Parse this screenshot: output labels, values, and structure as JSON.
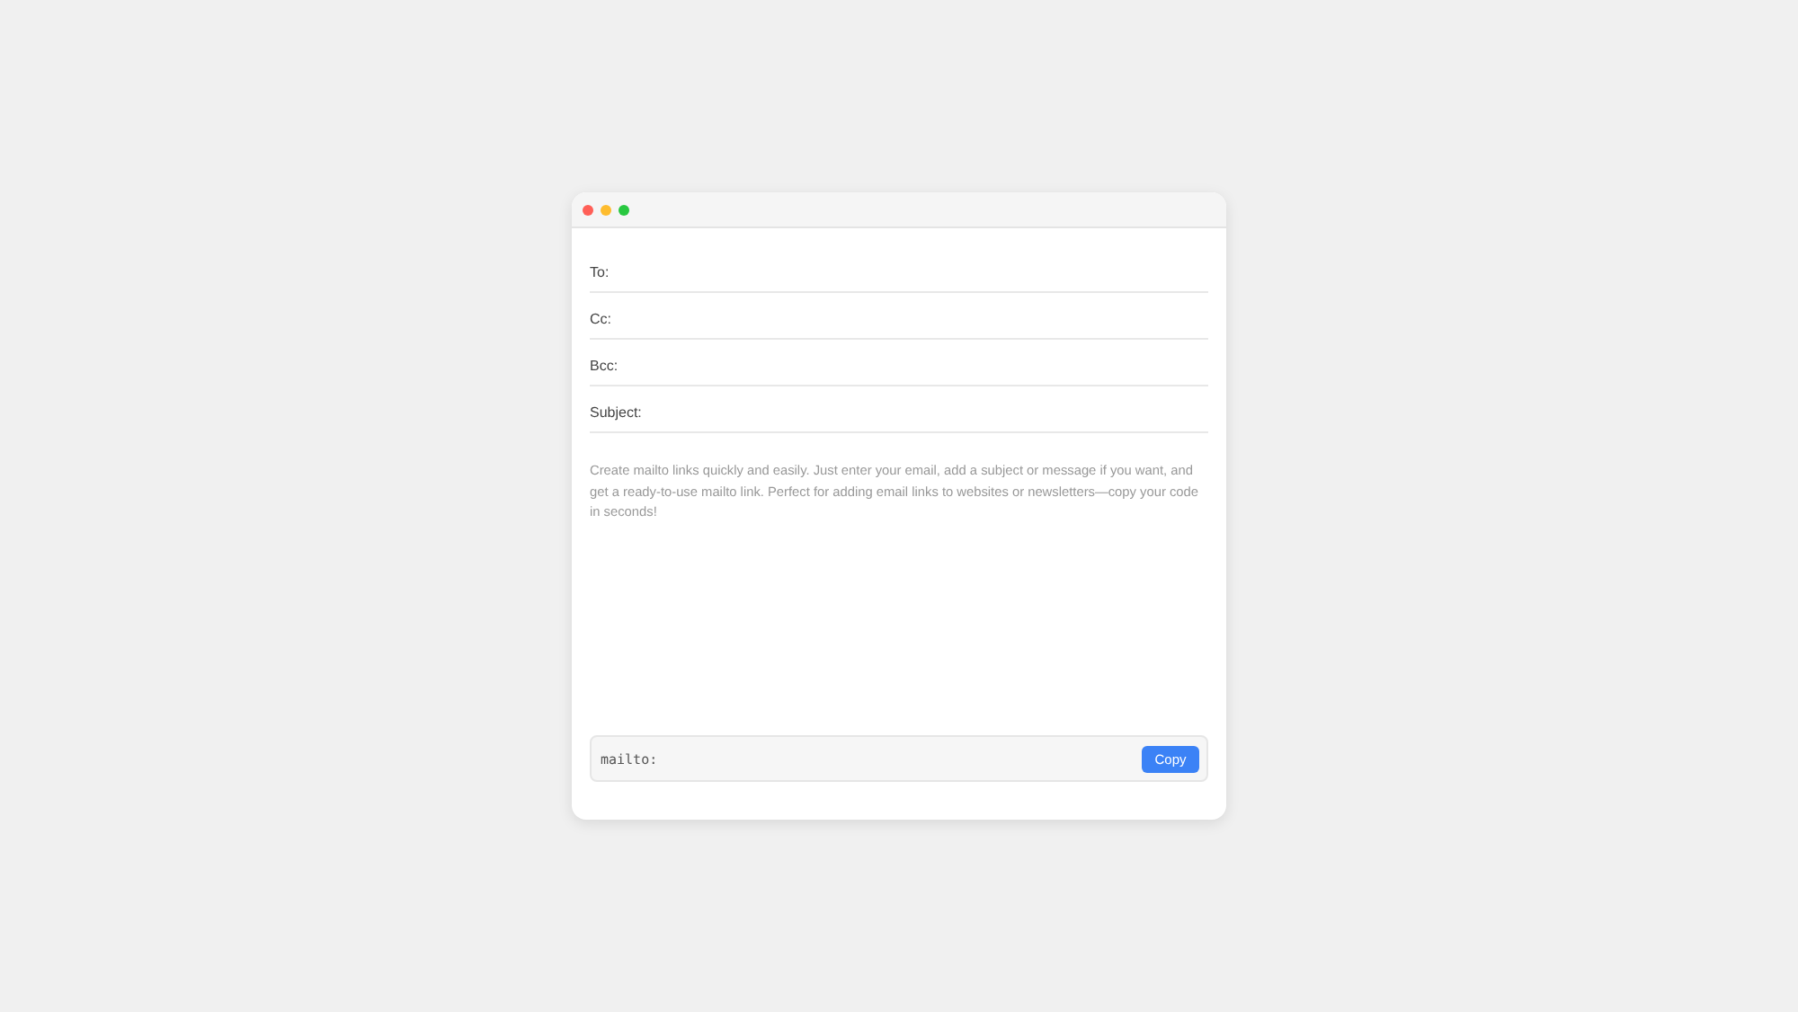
{
  "window": {
    "controls": [
      {
        "color": "#ff5f57"
      },
      {
        "color": "#febc2e"
      },
      {
        "color": "#28c840"
      }
    ]
  },
  "fields": [
    {
      "label": "To:"
    },
    {
      "label": "Cc:"
    },
    {
      "label": "Bcc:"
    },
    {
      "label": "Subject:"
    }
  ],
  "description": {
    "text": "Create mailto links quickly and easily. Just enter your email, add a subject or message if you want, and get a ready-to-use mailto link. Perfect for adding email links to websites or newsletters—copy your code in seconds!"
  },
  "output": {
    "value": "mailto:",
    "button": "Copy"
  }
}
